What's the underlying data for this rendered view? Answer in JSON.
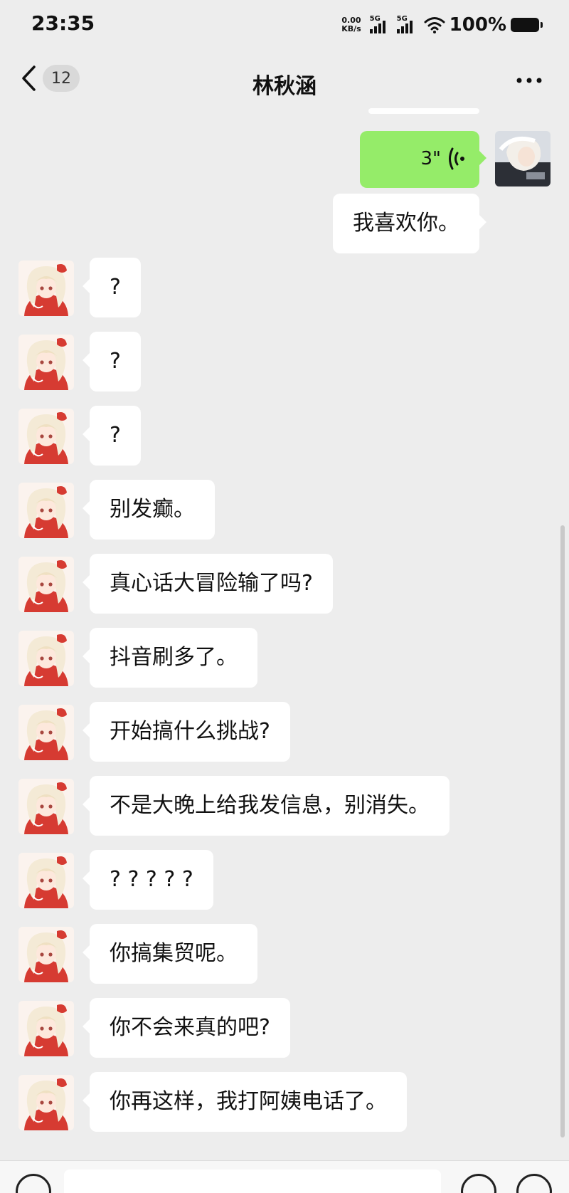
{
  "status_bar": {
    "time": "23:35",
    "net_speed_value": "0.00",
    "net_speed_unit": "KB/s",
    "signal_1": "5G",
    "signal_2": "5G",
    "battery": "100%"
  },
  "nav": {
    "unread_count": "12",
    "title": "林秋涵"
  },
  "messages": [
    {
      "side": "right",
      "type": "voice",
      "duration": "3\""
    },
    {
      "side": "right",
      "type": "text",
      "text": "我喜欢你。"
    },
    {
      "side": "left",
      "type": "text",
      "text": "?"
    },
    {
      "side": "left",
      "type": "text",
      "text": "?"
    },
    {
      "side": "left",
      "type": "text",
      "text": "?"
    },
    {
      "side": "left",
      "type": "text",
      "text": "别发癫。"
    },
    {
      "side": "left",
      "type": "text",
      "text": "真心话大冒险输了吗?"
    },
    {
      "side": "left",
      "type": "text",
      "text": "抖音刷多了。"
    },
    {
      "side": "left",
      "type": "text",
      "text": "开始搞什么挑战?"
    },
    {
      "side": "left",
      "type": "text",
      "text": "不是大晚上给我发信息，别消失。"
    },
    {
      "side": "left",
      "type": "text",
      "text": "? ? ? ? ?"
    },
    {
      "side": "left",
      "type": "text",
      "text": "你搞集贸呢。"
    },
    {
      "side": "left",
      "type": "text",
      "text": "你不会来真的吧?"
    },
    {
      "side": "left",
      "type": "text",
      "text": "你再这样，我打阿姨电话了。"
    }
  ],
  "colors": {
    "background": "#ededed",
    "voice_bubble": "#95ec69",
    "bubble": "#ffffff"
  },
  "icons": [
    "back-chevron-icon",
    "more-dots-icon",
    "voice-wave-icon",
    "wifi-icon",
    "battery-icon",
    "signal-bars-icon"
  ]
}
